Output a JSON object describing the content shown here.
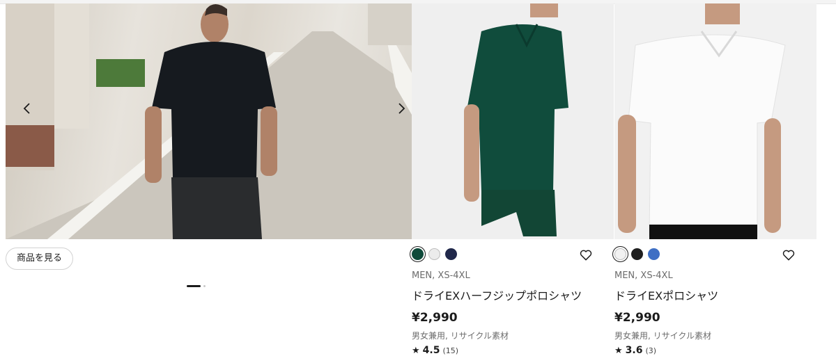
{
  "hero": {
    "cta_label": "商品を見る",
    "prev_icon": "chevron-left-icon",
    "next_icon": "chevron-right-icon",
    "slides_total": 2,
    "slide_active": 1
  },
  "products": [
    {
      "swatches": [
        "#0f4a3a",
        "#ececec",
        "#20284a"
      ],
      "selected_swatch": 0,
      "meta": "MEN, XS-4XL",
      "name": "ドライEXハーフジップポロシャツ",
      "price": "¥2,990",
      "tags": "男女兼用, リサイクル素材",
      "rating_star": "★",
      "rating": "4.5",
      "reviews": "(15)",
      "favorite_icon": "heart-icon"
    },
    {
      "swatches": [
        "#f2f2f2",
        "#1f1f1f",
        "#3f6fc4"
      ],
      "selected_swatch": 0,
      "meta": "MEN, XS-4XL",
      "name": "ドライEXポロシャツ",
      "price": "¥2,990",
      "tags": "男女兼用, リサイクル素材",
      "rating_star": "★",
      "rating": "3.6",
      "reviews": "(3)",
      "favorite_icon": "heart-icon"
    }
  ]
}
